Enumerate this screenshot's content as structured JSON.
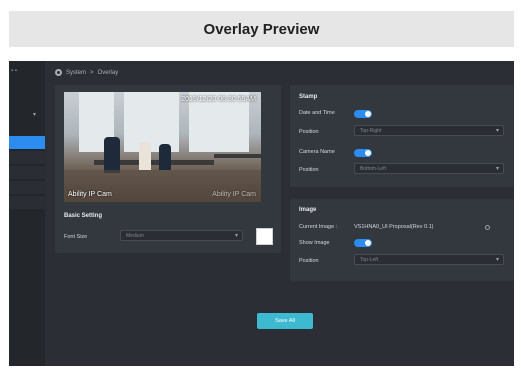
{
  "header": {
    "title": "Overlay Preview"
  },
  "breadcrumb": {
    "root": "System",
    "separator": ">",
    "current": "Overlay"
  },
  "preview": {
    "timestamp": "2019/12/20 06:30:55AM",
    "camera_name": "Ability IP Cam",
    "camera_name_right": "Ability IP Cam"
  },
  "basic_setting": {
    "heading": "Basic Setting",
    "font_size_label": "Font Size",
    "font_size_value": "Medium",
    "font_color": "#ffffff"
  },
  "stamp": {
    "heading": "Stamp",
    "date_time_label": "Date and Time",
    "date_time_enabled": true,
    "position_label": "Position",
    "date_time_position": "Top-Right",
    "camera_name_label": "Camera Name",
    "camera_name_enabled": true,
    "camera_name_position": "Bottom-Left"
  },
  "image": {
    "heading": "Image",
    "current_image_label": "Current Image :",
    "current_image_value": "VS1HNA0_UI Proposal(Rev 0.1)",
    "show_image_label": "Show Image",
    "show_image_enabled": true,
    "position_label": "Position",
    "position_value": "Top-Left"
  },
  "actions": {
    "save_label": "Save All"
  },
  "colors": {
    "accent": "#2d8cf0",
    "save_button": "#3dbad0",
    "background": "#2b2f35"
  }
}
